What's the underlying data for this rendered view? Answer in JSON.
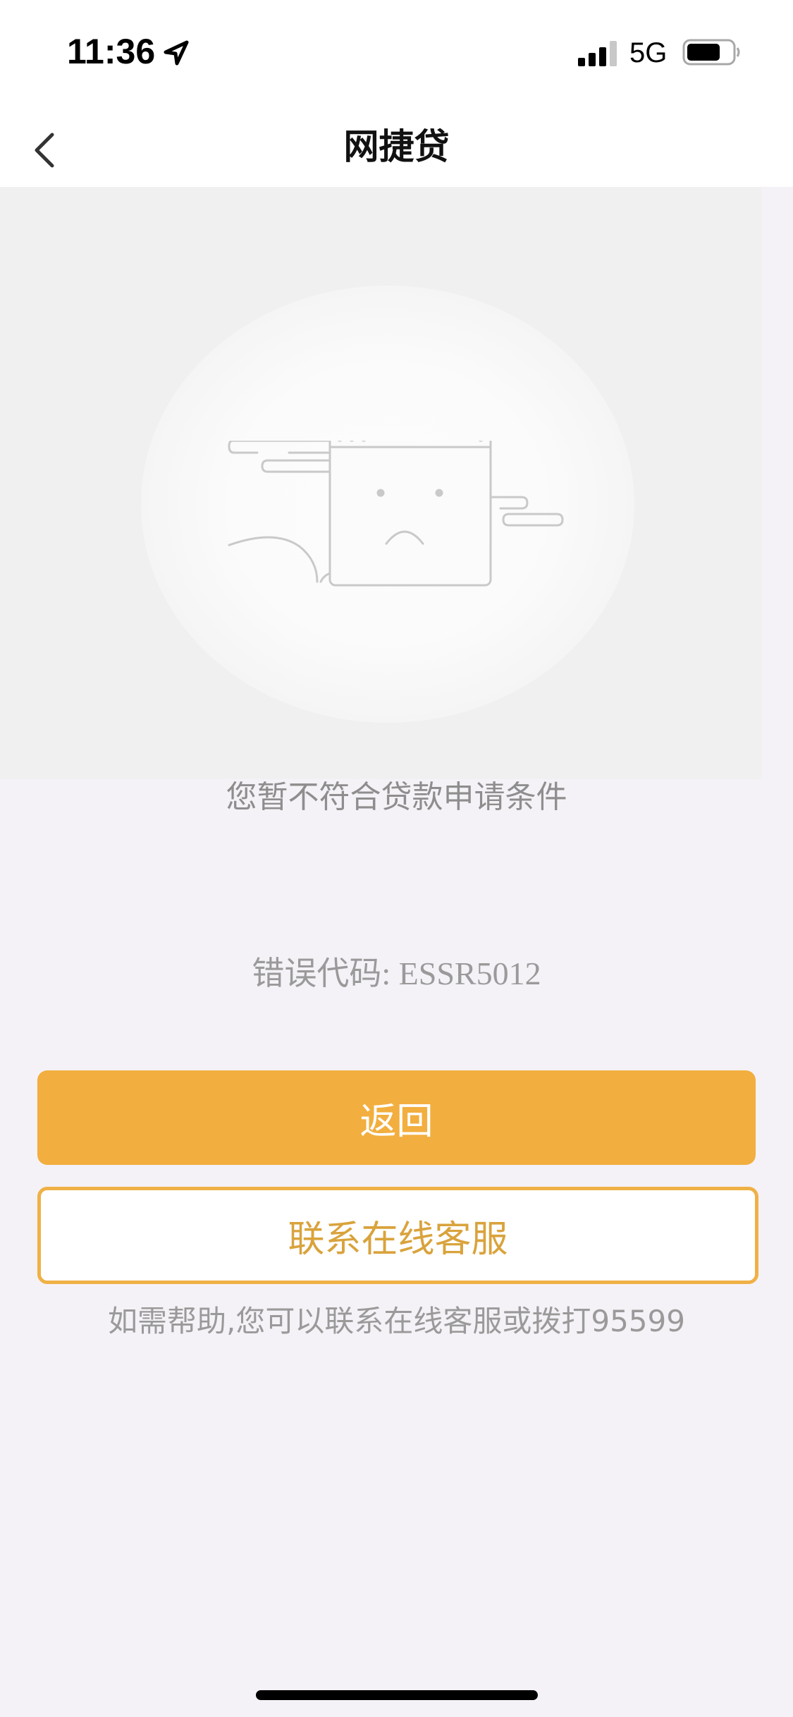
{
  "status_bar": {
    "time": "11:36",
    "network": "5G",
    "icons": [
      "location-arrow-icon",
      "signal-icon",
      "battery-icon"
    ]
  },
  "nav": {
    "back_icon": "chevron-left-icon",
    "title": "网捷贷"
  },
  "illustration": {
    "icon": "sad-browser-window-icon"
  },
  "main": {
    "message": "您暂不符合贷款申请条件",
    "error_code": "错误代码: ESSR5012",
    "primary_button": "返回",
    "secondary_button": "联系在线客服",
    "help_text": "如需帮助,您可以联系在线客服或拨打95599"
  },
  "colors": {
    "accent": "#f2ae3e",
    "accent_text": "#d9a33c",
    "background": "#f5f2f7"
  }
}
